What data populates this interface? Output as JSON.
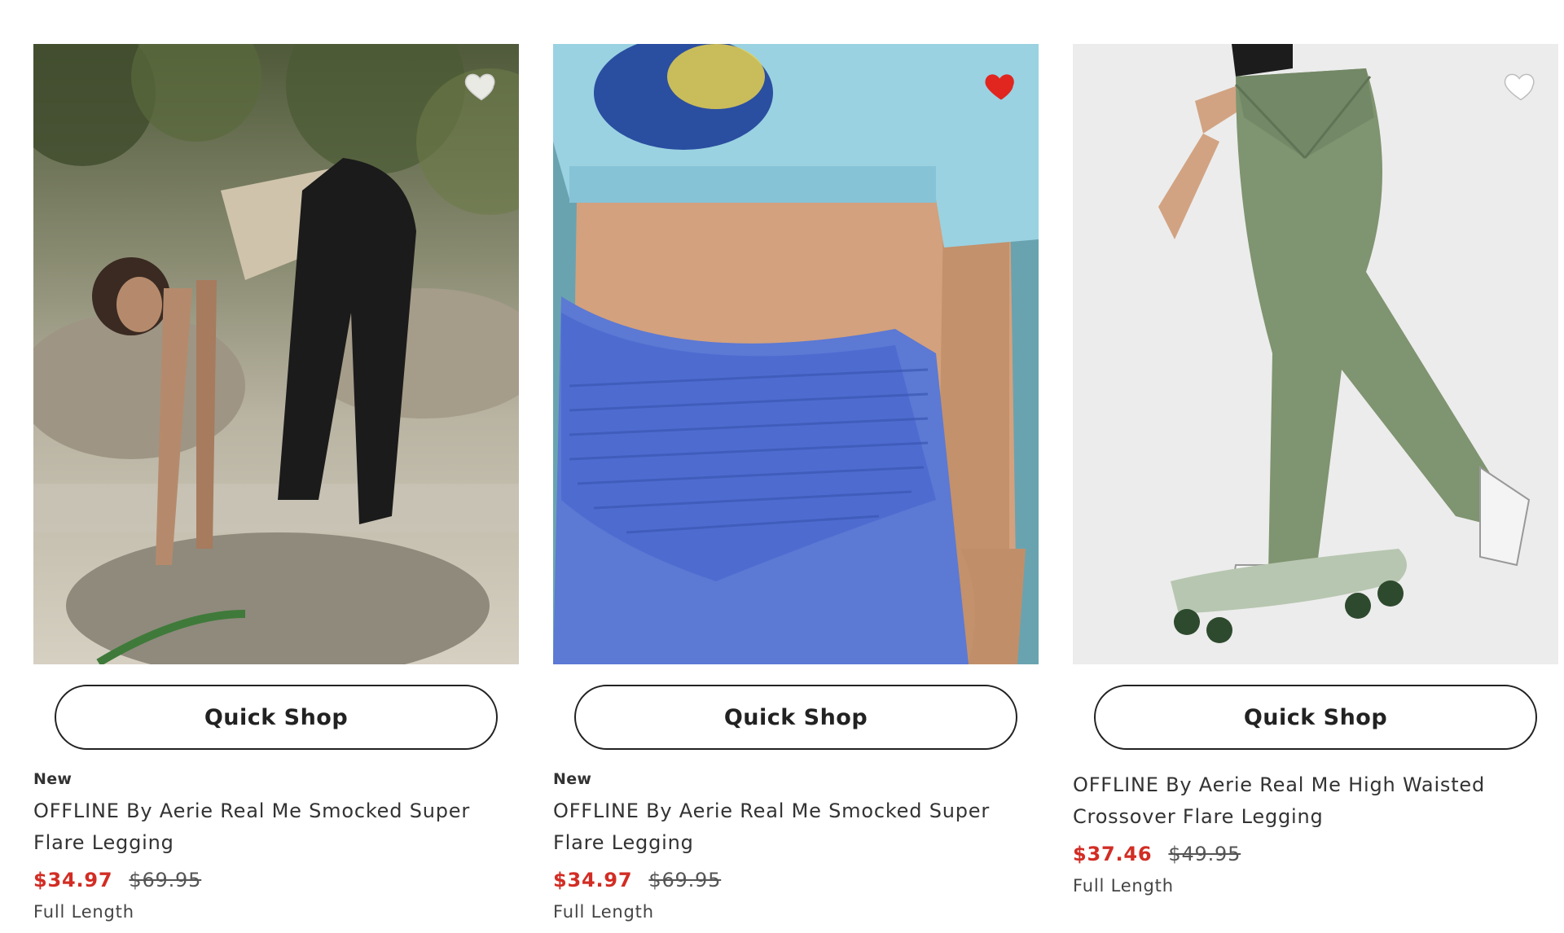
{
  "products": [
    {
      "badge": "New",
      "title": "OFFLINE By Aerie Real Me Smocked Super Flare Legging",
      "sale_price": "$34.97",
      "original_price": "$69.95",
      "length": "Full Length",
      "quick_shop_label": "Quick Shop",
      "favorited": false,
      "image": "Woman in black smocked flare leggings and beige knit top bending over rocks by water"
    },
    {
      "badge": "New",
      "title": "OFFLINE By Aerie Real Me Smocked Super Flare Legging",
      "sale_price": "$34.97",
      "original_price": "$69.95",
      "length": "Full Length",
      "quick_shop_label": "Quick Shop",
      "favorited": true,
      "image": "Close-up of blue smocked waistband flare leggings with light blue cropped tee"
    },
    {
      "badge": "",
      "title": "OFFLINE By Aerie Real Me High Waisted Crossover Flare Legging",
      "sale_price": "$37.46",
      "original_price": "$49.95",
      "length": "Full Length",
      "quick_shop_label": "Quick Shop",
      "favorited": false,
      "image": "Woman in olive green crossover flare leggings riding a skateboard"
    }
  ],
  "colors": {
    "sale_price": "#d22d24",
    "favorite_active": "#e0261f",
    "favorite_inactive": "#ffffff"
  },
  "icons": {
    "favorite": "heart-icon"
  }
}
